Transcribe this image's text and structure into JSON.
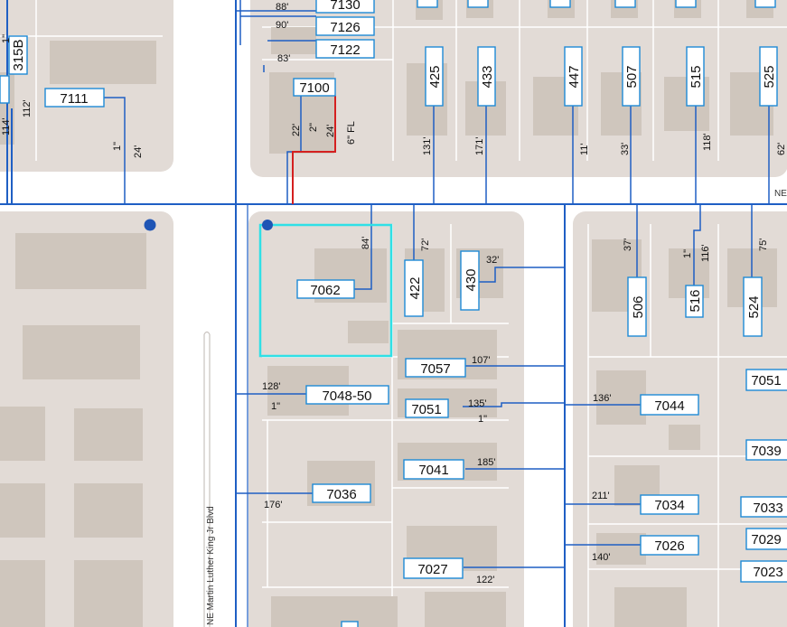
{
  "colors": {
    "block": "#e2dbd6",
    "building": "#cfc6bd",
    "street": "#ffffff",
    "lot_line": "#ffffff",
    "curb": "#c9c3bf",
    "water_main": "#1f5fc4",
    "label_box": "#1e8ad6",
    "highlight_service": "#d42020",
    "selected_parcel": "#2fe0e6",
    "valve": "#1f55b5"
  },
  "streets": {
    "vertical": "NE Martin Luther King Jr Blvd",
    "horizontal": "NE"
  },
  "parcels": [
    {
      "label": "7130"
    },
    {
      "label": "7126"
    },
    {
      "label": "7122"
    },
    {
      "label": "7100"
    },
    {
      "label": "7111"
    },
    {
      "label": "315B"
    },
    {
      "label": "425"
    },
    {
      "label": "433"
    },
    {
      "label": "447"
    },
    {
      "label": "507"
    },
    {
      "label": "515"
    },
    {
      "label": "525"
    },
    {
      "label": "7062"
    },
    {
      "label": "422"
    },
    {
      "label": "430"
    },
    {
      "label": "506"
    },
    {
      "label": "516"
    },
    {
      "label": "524"
    },
    {
      "label": "7057"
    },
    {
      "label": "7048-50"
    },
    {
      "label": "7051"
    },
    {
      "label": "7044"
    },
    {
      "label": "7051"
    },
    {
      "label": "7039"
    },
    {
      "label": "7041"
    },
    {
      "label": "7036"
    },
    {
      "label": "7034"
    },
    {
      "label": "7033"
    },
    {
      "label": "7026"
    },
    {
      "label": "7029"
    },
    {
      "label": "7027"
    },
    {
      "label": "7023"
    }
  ],
  "dimensions": [
    "88'",
    "90'",
    "83'",
    "112'",
    "114'",
    "1\"",
    "24'",
    "22'",
    "2\"",
    "24'",
    "6\" FL",
    "131'",
    "171'",
    "11'",
    "33'",
    "118'",
    "62'",
    "84'",
    "72'",
    "32'",
    "37'",
    "1\"",
    "116'",
    "75'",
    "128'",
    "1\"",
    "107'",
    "135'",
    "1\"",
    "136'",
    "185'",
    "211'",
    "176'",
    "140'",
    "122'",
    "1\""
  ]
}
